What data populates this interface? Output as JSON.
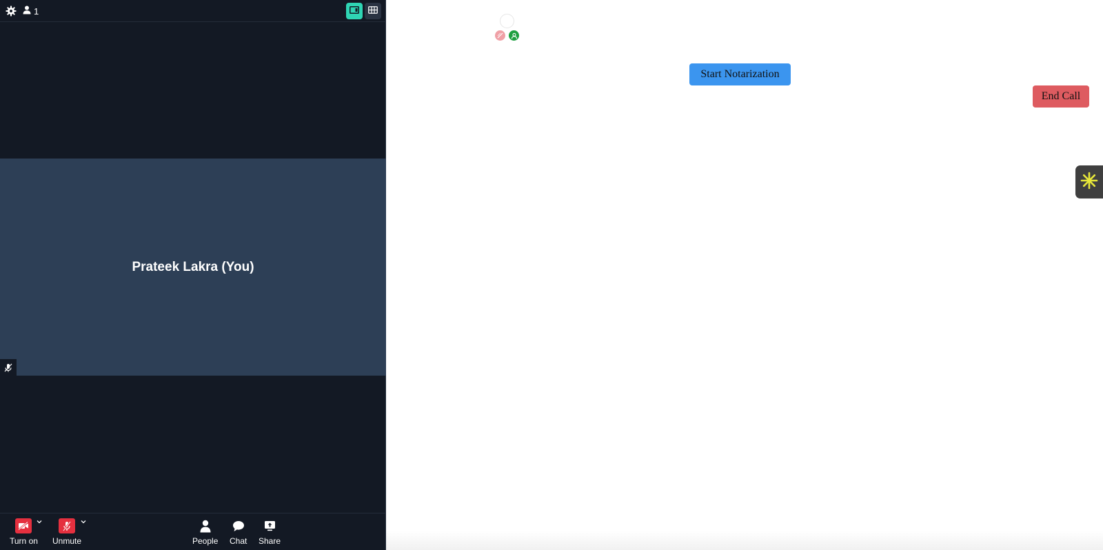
{
  "topbar": {
    "participant_count": "1"
  },
  "video_tile": {
    "participant_name": "Prateek Lakra (You)"
  },
  "controls": {
    "video_label": "Turn on",
    "audio_label": "Unmute",
    "people_label": "People",
    "chat_label": "Chat",
    "share_label": "Share"
  },
  "actions": {
    "start_notarization": "Start Notarization",
    "end_call": "End Call"
  },
  "icons": {
    "settings": "gear-icon",
    "people": "person-icon",
    "speaker_view": "speaker-view-icon",
    "grid_view": "grid-view-icon",
    "mic_muted": "mic-off-icon",
    "video_off": "video-off-icon",
    "chat": "chat-bubble-icon",
    "share": "share-screen-icon",
    "widget": "asterisk-icon"
  },
  "colors": {
    "panel_bg": "#131924",
    "tile_bg": "#2d3f56",
    "accent": "#2fd5b4",
    "muted_red": "#e5303f",
    "start_button": "#3b95ef",
    "end_button": "#de5b60",
    "widget_bg": "#3f3f3f",
    "widget_icon": "#e8e83a"
  }
}
